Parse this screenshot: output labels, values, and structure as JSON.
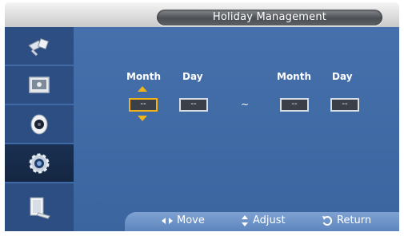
{
  "title": "Holiday Management",
  "sidebar": {
    "items": [
      {
        "icon": "input-icon",
        "active": false
      },
      {
        "icon": "picture-icon",
        "active": false
      },
      {
        "icon": "sound-icon",
        "active": false
      },
      {
        "icon": "setup-icon",
        "active": true
      },
      {
        "icon": "multi-control-icon",
        "active": false
      }
    ]
  },
  "fields": {
    "start": {
      "month_label": "Month",
      "day_label": "Day",
      "month_value": "--",
      "day_value": "--"
    },
    "separator": "~",
    "end": {
      "month_label": "Month",
      "day_label": "Day",
      "month_value": "--",
      "day_value": "--"
    }
  },
  "hints": {
    "move": "Move",
    "adjust": "Adjust",
    "return": "Return"
  },
  "colors": {
    "accent": "#f2b21a",
    "panel": "#3f6aa5",
    "sidebar": "#2c4e83"
  }
}
